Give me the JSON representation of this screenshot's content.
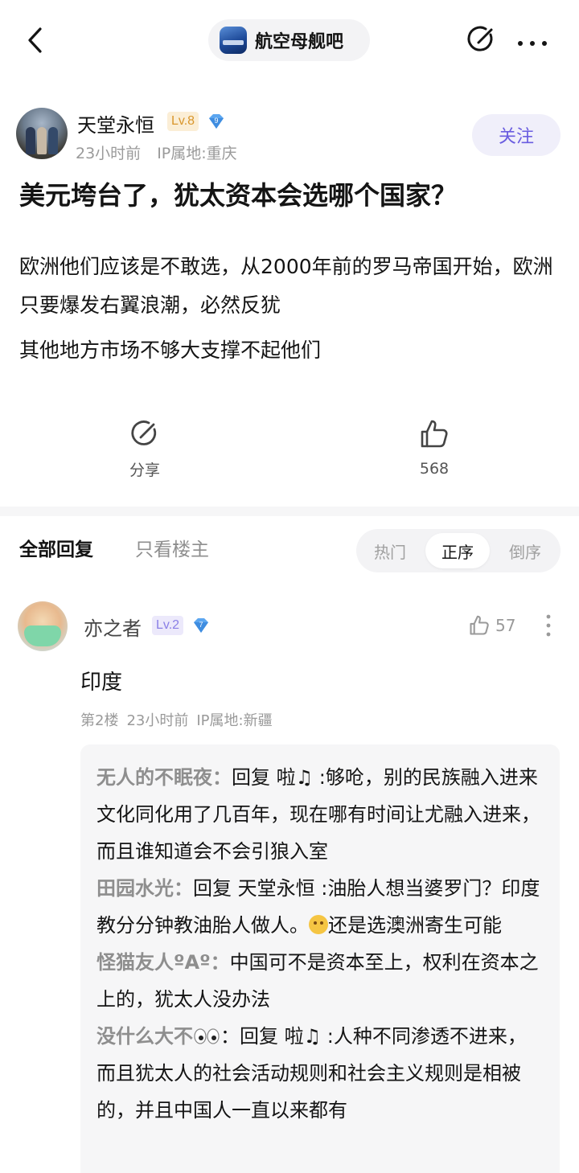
{
  "topbar": {
    "forum_name": "航空母舰吧"
  },
  "post": {
    "author": {
      "name": "天堂永恒",
      "level": "Lv.8",
      "badge_number": "9",
      "time": "23小时前",
      "ip": "IP属地:重庆",
      "follow_label": "关注"
    },
    "title": "美元垮台了，犹太资本会选哪个国家？",
    "paragraphs": [
      "欧洲他们应该是不敢选，从2000年前的罗马帝国开始，欧洲只要爆发右翼浪潮，必然反犹",
      "其他地方市场不够大支撑不起他们"
    ],
    "actions": {
      "share_label": "分享",
      "like_count": "568"
    }
  },
  "replies": {
    "tab_all": "全部回复",
    "tab_owner": "只看楼主",
    "sort": {
      "hot": "热门",
      "asc": "正序",
      "desc": "倒序"
    },
    "items": [
      {
        "user": "亦之者",
        "level": "Lv.2",
        "badge_number": "7",
        "likes": "57",
        "text": "印度",
        "floor": "第2楼",
        "time": "23小时前",
        "ip": "IP属地:新疆",
        "sub_replies": [
          {
            "user": "无人的不眠夜：",
            "text_a": "回复 啦♫ :够呛，别的民族融入进来文化同化用了几百年，现在哪有时间让尤融入进来，而且谁知道会不会引狼入室"
          },
          {
            "user": "田园水光：",
            "text_a": "回复 天堂永恒 :油胎人想当婆罗门？印度教分分钟教油胎人做人。",
            "text_b": "还是选澳洲寄生可能"
          },
          {
            "user": "怪猫友人ºAº：",
            "text_a": "中国可不是资本至上，权利在资本之上的，犹太人没办法"
          },
          {
            "user": "没什么大不",
            "text_a": "：回复 啦♫ :人种不同渗透不进来，而且犹太人的社会活动规则和社会主义规则是相被的，并且中国人一直以来都有"
          }
        ]
      }
    ]
  },
  "colors": {
    "accent": "#6a5de0",
    "level_gold": "#d9962c",
    "level_purple": "#8a7fe6"
  }
}
